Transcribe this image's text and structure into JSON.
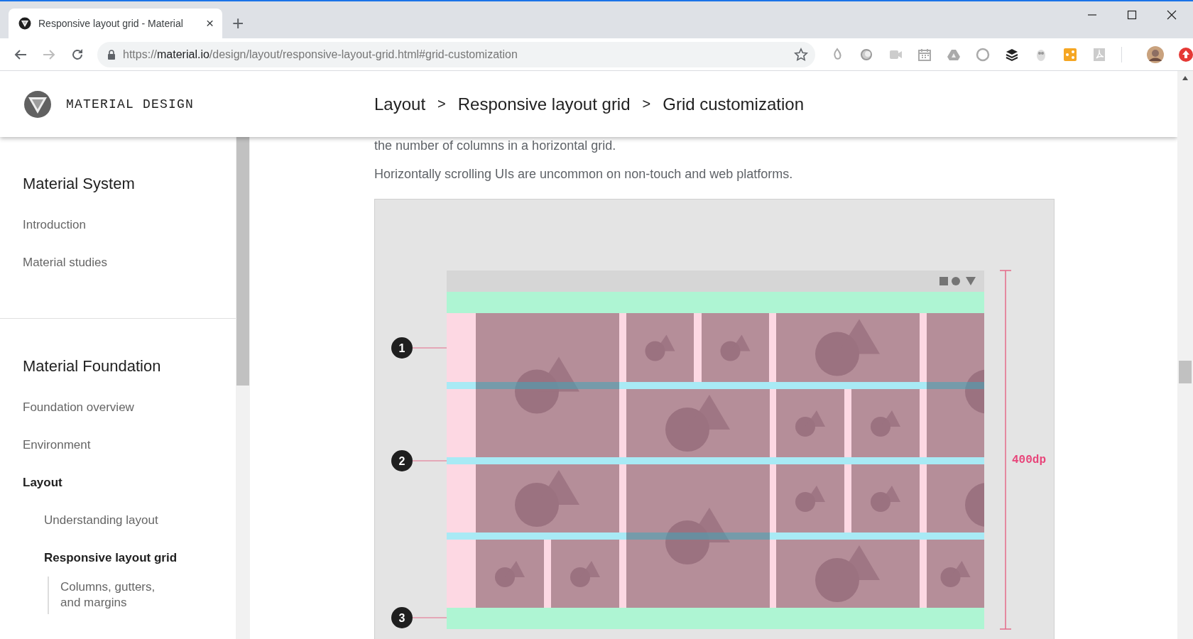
{
  "browser": {
    "tab": {
      "title": "Responsive layout grid - Material",
      "close": "×"
    },
    "new_tab": "+",
    "forward": {
      "disabled": true
    },
    "address": {
      "scheme": "https://",
      "host": "material.io",
      "path": "/design/layout/responsive-layout-grid.html#grid-customization"
    }
  },
  "site": {
    "logo_text": "MATERIAL DESIGN",
    "breadcrumb": [
      {
        "kind": "link",
        "label": "Layout"
      },
      {
        "kind": "separator",
        "label": ">"
      },
      {
        "kind": "link",
        "label": "Responsive layout grid"
      },
      {
        "kind": "separator",
        "label": ">"
      },
      {
        "kind": "current",
        "label": "Grid customization"
      }
    ]
  },
  "sidebar": {
    "sections": [
      {
        "title": "Material System",
        "items": [
          {
            "label": "Introduction",
            "selected": false
          },
          {
            "label": "Material studies",
            "selected": false
          }
        ]
      },
      {
        "title": "Material Foundation",
        "items": [
          {
            "label": "Foundation overview",
            "selected": false
          },
          {
            "label": "Environment",
            "selected": false
          },
          {
            "label": "Layout",
            "selected": true,
            "children": [
              {
                "label": "Understanding layout",
                "selected": false
              },
              {
                "label": "Responsive layout grid",
                "selected": true,
                "children": [
                  {
                    "label": "Columns, gutters, and margins",
                    "selected": false
                  }
                ]
              }
            ]
          }
        ]
      }
    ]
  },
  "article": {
    "paragraphs": [
      "the number of columns in a horizontal grid.",
      "Horizontally scrolling UIs are uncommon on non-touch and web platforms."
    ],
    "figure": {
      "callouts": [
        "1",
        "2",
        "3"
      ],
      "height_label": "400dp"
    }
  }
}
